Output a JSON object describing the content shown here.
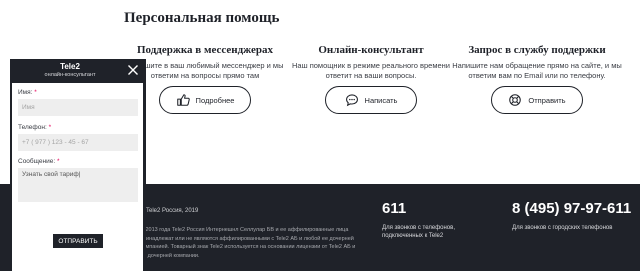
{
  "section": {
    "title": "Персональная помощь"
  },
  "cards": [
    {
      "title": "Поддержка в мессенджерах",
      "desc": "Напишите в ваш любимый мессенджер и мы ответим на вопросы прямо там",
      "button": "Подробнее",
      "icon": "thumbs-up-icon"
    },
    {
      "title": "Онлайн-консультант",
      "desc": "Наш помощник в режиме реального времени ответит на ваши вопросы.",
      "button": "Написать",
      "icon": "chat-bubble-icon"
    },
    {
      "title": "Запрос в службу поддержки",
      "desc": "Напишите нам обращение прямо на сайте, и мы ответим вам по Email или по телефону.",
      "button": "Отправить",
      "icon": "lifebuoy-icon"
    }
  ],
  "footer": {
    "copyright": "© Tele2 Россия, 2019",
    "legal": "С 2013 года Tele2 Россия Интернешнл Селлулар БВ и ее аффилированные лица принадлежат или не являются аффилированными с Tele2 АБ и любой ее дочерней компанией. Товарный знак Tele2 используется на основании лицензии от Tele2 АБ и ее дочерней компании.",
    "phone_mobile": "611",
    "phone_mobile_desc": "Для звонков с телефонов, подключенных к Tele2",
    "phone_city": "8 (495) 97-97-611",
    "phone_city_desc": "Для звонков с городских телефонов"
  },
  "chat_widget": {
    "brand": "Tele2",
    "subtitle": "онлайн-консультант",
    "name_label": "Имя:",
    "name_placeholder": "Имя",
    "phone_label": "Телефон:",
    "phone_placeholder": "+7 ( 977 ) 123 - 45 - 67",
    "message_label": "Сообщение:",
    "message_value": "Узнать свой тариф|",
    "required_mark": "*",
    "submit": "ОТПРАВИТЬ"
  },
  "colors": {
    "dark": "#1f2229",
    "required": "#e5005a",
    "field_bg": "#eeeeee"
  }
}
